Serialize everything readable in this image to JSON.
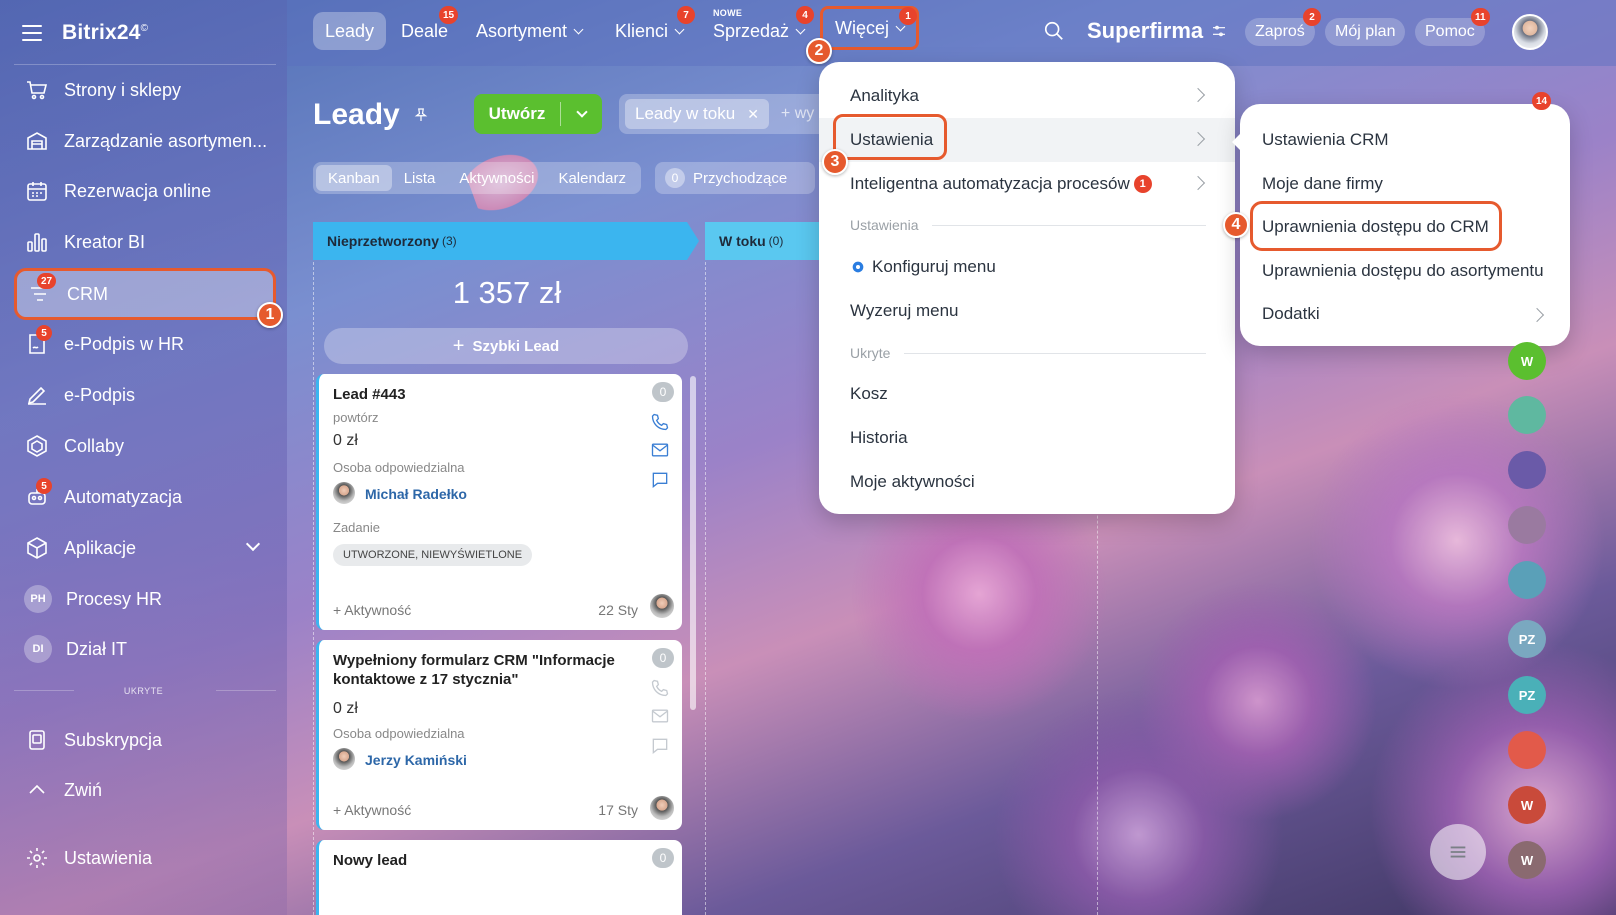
{
  "app": {
    "name": "Bitrix24",
    "logo_mark": "©"
  },
  "sidebar": {
    "items": [
      {
        "label": "Strony i sklepy",
        "icon": "cart-icon"
      },
      {
        "label": "Zarządzanie asortymen...",
        "icon": "warehouse-icon"
      },
      {
        "label": "Rezerwacja online",
        "icon": "calendar-icon"
      },
      {
        "label": "Kreator BI",
        "icon": "bar-chart-icon"
      },
      {
        "label": "CRM",
        "icon": "crm-filter-icon",
        "badge": "27"
      },
      {
        "label": "e-Podpis w HR",
        "icon": "sign-doc-icon",
        "badge": "5"
      },
      {
        "label": "e-Podpis",
        "icon": "pen-icon"
      },
      {
        "label": "Collaby",
        "icon": "hexagon-icon"
      },
      {
        "label": "Automatyzacja",
        "icon": "robot-icon",
        "badge": "5"
      },
      {
        "label": "Aplikacje",
        "icon": "cube-icon"
      },
      {
        "label": "Procesy HR",
        "initials": "PH"
      },
      {
        "label": "Dział IT",
        "initials": "DI"
      }
    ],
    "hidden_label": "UKRYTE",
    "subscription": "Subskrypcja",
    "collapse": "Zwiń",
    "settings": "Ustawienia"
  },
  "topnav": {
    "tabs": [
      {
        "label": "Leady",
        "active": true
      },
      {
        "label": "Deale",
        "badge": "15"
      },
      {
        "label": "Asortyment"
      },
      {
        "label": "Klienci",
        "badge": "7"
      },
      {
        "label": "Sprzedaż",
        "badge": "4",
        "tag": "NOWE"
      },
      {
        "label": "Więcej",
        "badge": "1"
      }
    ],
    "company": "Superfirma",
    "invite": "Zaproś",
    "invite_badge": "2",
    "my_plan": "Mój plan",
    "help": "Pomoc",
    "help_badge": "11"
  },
  "page": {
    "title": "Leady",
    "create": "Utwórz",
    "filter_chip": "Leady w toku",
    "filter_more": "+ wy",
    "views": [
      "Kanban",
      "Lista",
      "Aktywności",
      "Kalendarz"
    ],
    "incoming_count": "0",
    "incoming_label": "Przychodzące"
  },
  "kanban": {
    "stage1": {
      "name": "Nieprzetworzony",
      "count": "(3)",
      "sum": "1 357 zł",
      "quick": "Szybki Lead"
    },
    "stage2": {
      "name": "W toku",
      "count": "(0)"
    },
    "cards": [
      {
        "title": "Lead #443",
        "sub": "powtórz",
        "amount": "0 zł",
        "resp_label": "Osoba odpowiedzialna",
        "resp": "Michał Radełko",
        "task_label": "Zadanie",
        "tag": "UTWORZONE, NIEWYŚWIETLONE",
        "activity": "+ Aktywność",
        "date": "22 Sty",
        "count": "0"
      },
      {
        "title_line1": "Wypełniony formularz CRM \"Informacje",
        "title_line2": "kontaktowe z 17 stycznia\"",
        "amount": "0 zł",
        "resp_label": "Osoba odpowiedzialna",
        "resp": "Jerzy Kamiński",
        "activity": "+ Aktywność",
        "date": "17 Sty",
        "count": "0"
      },
      {
        "title": "Nowy lead",
        "count": "0"
      }
    ]
  },
  "more_menu": {
    "items": [
      "Analityka",
      "Ustawienia",
      "Inteligentna automatyzacja procesów"
    ],
    "item3_badge": "1",
    "section_settings": "Ustawienia",
    "configure": "Konfiguruj menu",
    "reset": "Wyzeruj menu",
    "section_hidden": "Ukryte",
    "hidden_items": [
      "Kosz",
      "Historia",
      "Moje aktywności"
    ]
  },
  "settings_submenu": {
    "items": [
      "Ustawienia CRM",
      "Moje dane firmy",
      "Uprawnienia dostępu do CRM",
      "Uprawnienia dostępu do asortymentu",
      "Dodatki"
    ]
  },
  "annotations": [
    "1",
    "2",
    "3",
    "4"
  ],
  "right_rail": {
    "top_badge": "14",
    "items": [
      "W",
      "PZ",
      "PZ",
      "W",
      "W"
    ]
  },
  "colors": {
    "accent": "#e65a2e",
    "create": "#5bbf2f",
    "stage1": "#3bb5ef",
    "badge": "#e8432c",
    "link": "#2d67a8"
  }
}
